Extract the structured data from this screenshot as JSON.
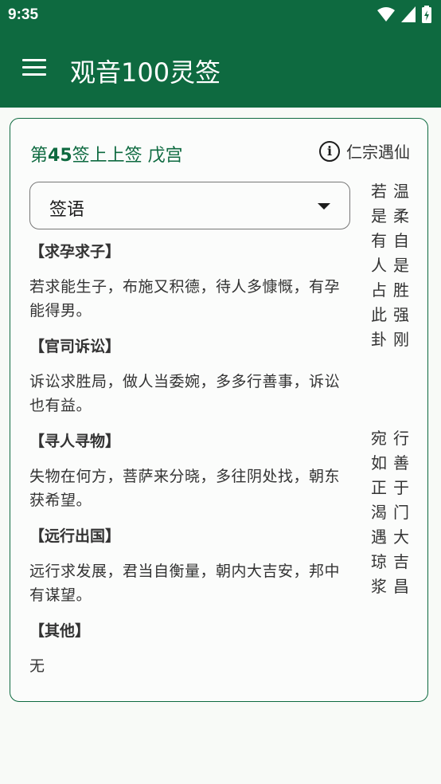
{
  "status": {
    "time": "9:35"
  },
  "appbar": {
    "title": "观音100灵签"
  },
  "lot": {
    "number_prefix": "第",
    "number": "45",
    "suffix": "签",
    "grade": "上上签",
    "palace": "戊宫",
    "story": "仁宗遇仙"
  },
  "dropdown": {
    "selected": "签语"
  },
  "sections": [
    {
      "head": "【求孕求子】",
      "body": "若求能生子，布施又积德，待人多慷慨，有孕能得男。"
    },
    {
      "head": "【官司诉讼】",
      "body": "诉讼求胜局，做人当委婉，多多行善事，诉讼也有益。"
    },
    {
      "head": "【寻人寻物】",
      "body": "失物在何方，菩萨来分晓，多往阴处找，朝东获希望。"
    },
    {
      "head": "【远行出国】",
      "body": "远行求发展，君当自衡量，朝内大吉安，邦中有谋望。"
    },
    {
      "head": "【其他】",
      "body": "无"
    }
  ],
  "poem": {
    "col_right": "温柔自是胜强刚\n\n行善于门大吉昌",
    "col_left": "若是有人占此卦\n\n宛如正渴遇琼浆"
  },
  "colors": {
    "primary": "#0e6a40",
    "background": "#f8faf7"
  },
  "icons": [
    "wifi-icon",
    "signal-icon",
    "battery-icon",
    "menu-icon",
    "info-icon",
    "dropdown-arrow-icon"
  ]
}
